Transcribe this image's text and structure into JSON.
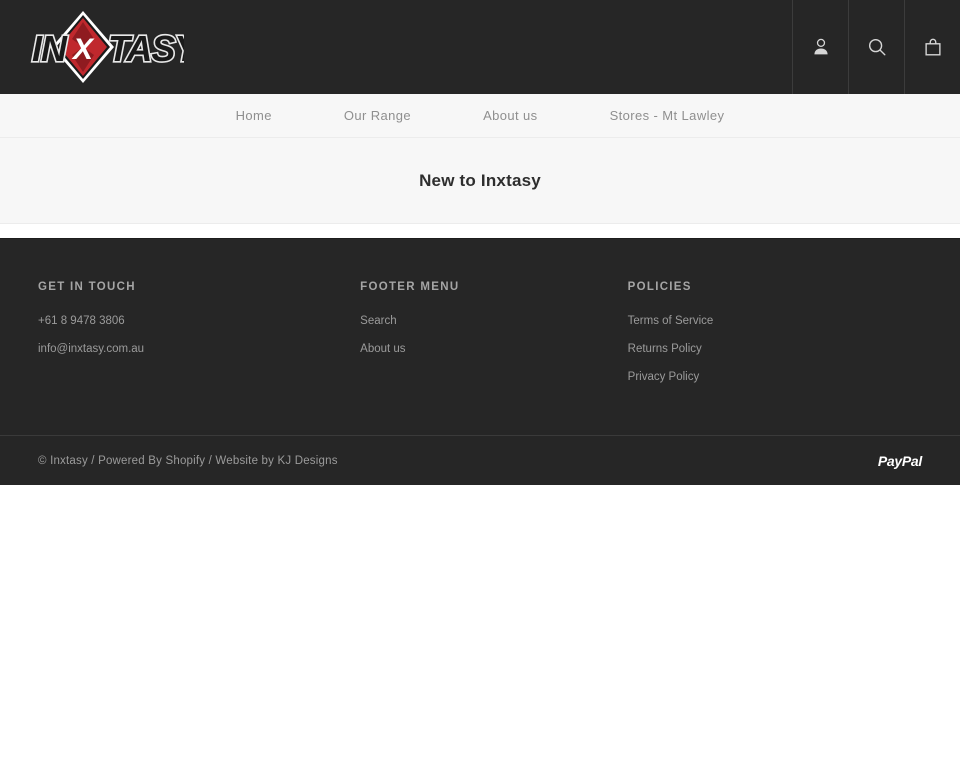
{
  "header": {
    "logo": {
      "text": "INXTASY",
      "pre": "IN",
      "post": "TASY",
      "mark": "X",
      "alt": "Inxtasy logo",
      "diamond_color": "#c0282d",
      "background": "#262626"
    },
    "icons": [
      {
        "name": "account-icon",
        "label": "Account"
      },
      {
        "name": "search-icon",
        "label": "Search"
      },
      {
        "name": "cart-icon",
        "label": "Cart"
      }
    ]
  },
  "nav": {
    "items": [
      {
        "label": "Home"
      },
      {
        "label": "Our Range"
      },
      {
        "label": "About us"
      },
      {
        "label": "Stores - Mt Lawley"
      }
    ]
  },
  "banner": {
    "title": "New to Inxtasy"
  },
  "footer": {
    "columns": [
      {
        "heading": "GET IN TOUCH",
        "links": [
          {
            "label": "+61 8 9478 3806"
          },
          {
            "label": "info@inxtasy.com.au"
          }
        ]
      },
      {
        "heading": "FOOTER MENU",
        "links": [
          {
            "label": "Search"
          },
          {
            "label": "About us"
          }
        ]
      },
      {
        "heading": "POLICIES",
        "links": [
          {
            "label": "Terms of Service"
          },
          {
            "label": "Returns Policy"
          },
          {
            "label": "Privacy Policy"
          }
        ]
      }
    ],
    "copyright": "© Inxtasy / Powered By Shopify / Website by KJ Designs",
    "payment": {
      "label": "PayPal"
    }
  },
  "colors": {
    "dark": "#262626",
    "light_panel": "#f7f7f7",
    "accent_red": "#c0282d",
    "muted_text": "#9b9b9b"
  }
}
